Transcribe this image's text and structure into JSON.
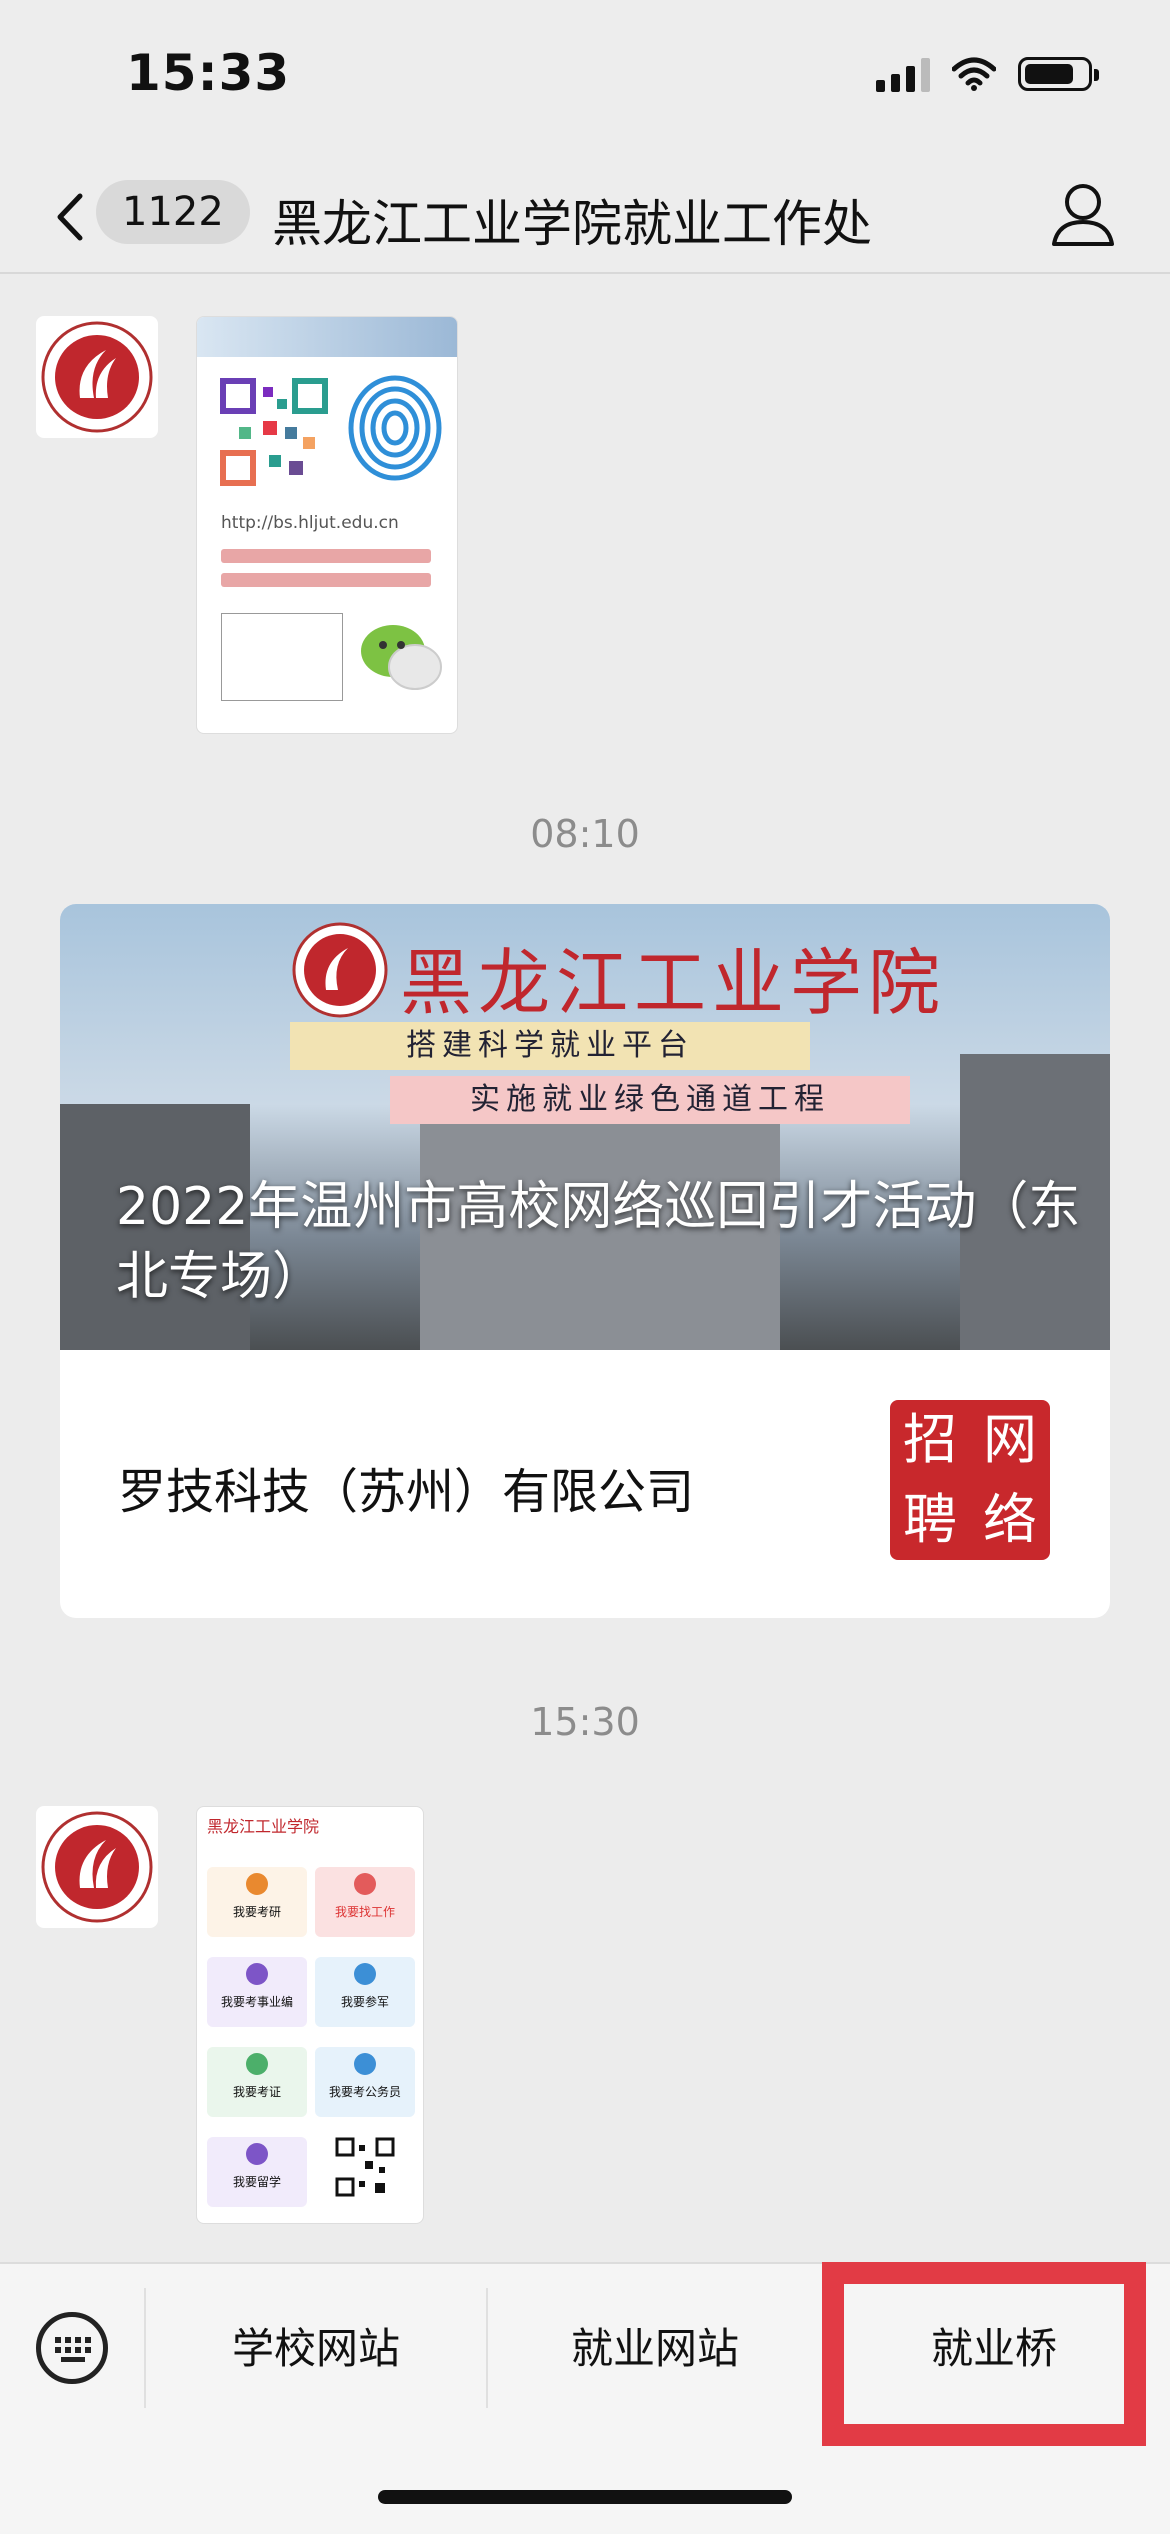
{
  "status_bar": {
    "time": "15:33"
  },
  "header": {
    "unread_count": "1122",
    "title": "黑龙江工业学院就业工作处"
  },
  "messages": {
    "qr_image": {
      "url_text": "http://bs.hljut.edu.cn"
    },
    "timestamp_1": "08:10",
    "article": {
      "banner_school_name": "黑龙江工业学院",
      "banner_slogan_1": "搭建科学就业平台",
      "banner_slogan_2": "实施就业绿色通道工程",
      "title": "2022年温州市高校网络巡回引才活动（东北专场）",
      "subtitle": "罗技科技（苏州）有限公司",
      "seal_chars": [
        "招",
        "网",
        "聘",
        "络"
      ]
    },
    "timestamp_2": "15:30",
    "menu_image": {
      "header": "黑龙江工业学院",
      "items": [
        "我要考研",
        "我要找工作",
        "我要考事业编",
        "我要参军",
        "我要考证",
        "我要考公务员",
        "我要留学"
      ]
    }
  },
  "bottom_menu": {
    "items": [
      "学校网站",
      "就业网站",
      "就业桥"
    ]
  },
  "colors": {
    "highlight": "#e23b45",
    "background": "#ececec"
  }
}
